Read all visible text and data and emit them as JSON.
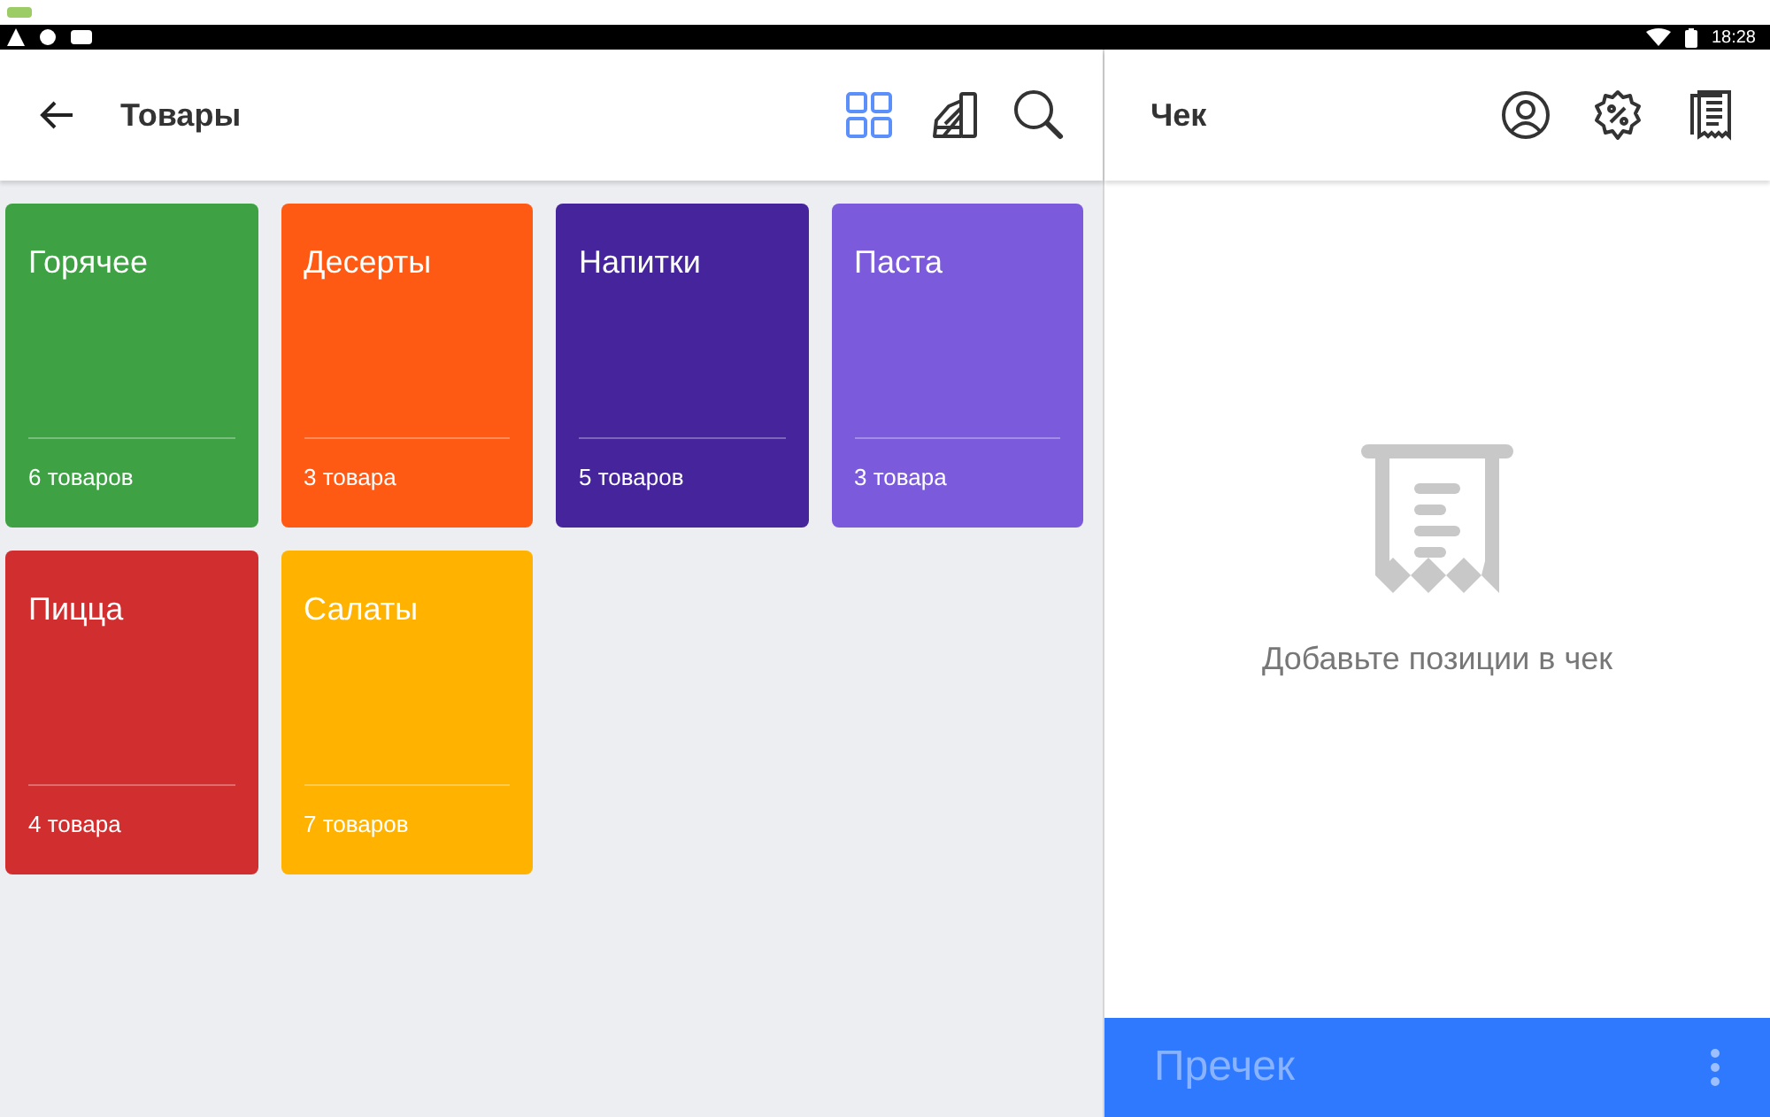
{
  "status_bar": {
    "time": "18:28"
  },
  "catalog": {
    "title": "Товары",
    "views": [
      {
        "kind": "grid",
        "selected": true
      },
      {
        "kind": "palette",
        "selected": false
      }
    ]
  },
  "categories": [
    {
      "name": "Горячее",
      "count": "6 товаров",
      "color": "#3ea244"
    },
    {
      "name": "Десерты",
      "count": "3 товара",
      "color": "#ff5a14"
    },
    {
      "name": "Напитки",
      "count": "5 товаров",
      "color": "#45249c"
    },
    {
      "name": "Паста",
      "count": "3 товара",
      "color": "#7b5bdb"
    },
    {
      "name": "Пицца",
      "count": "4 товара",
      "color": "#d12f2f"
    },
    {
      "name": "Салаты",
      "count": "7 товаров",
      "color": "#ffb300"
    }
  ],
  "receipt": {
    "title": "Чек",
    "empty_message": "Добавьте позиции в чек",
    "precheck_button": "Пречек"
  }
}
